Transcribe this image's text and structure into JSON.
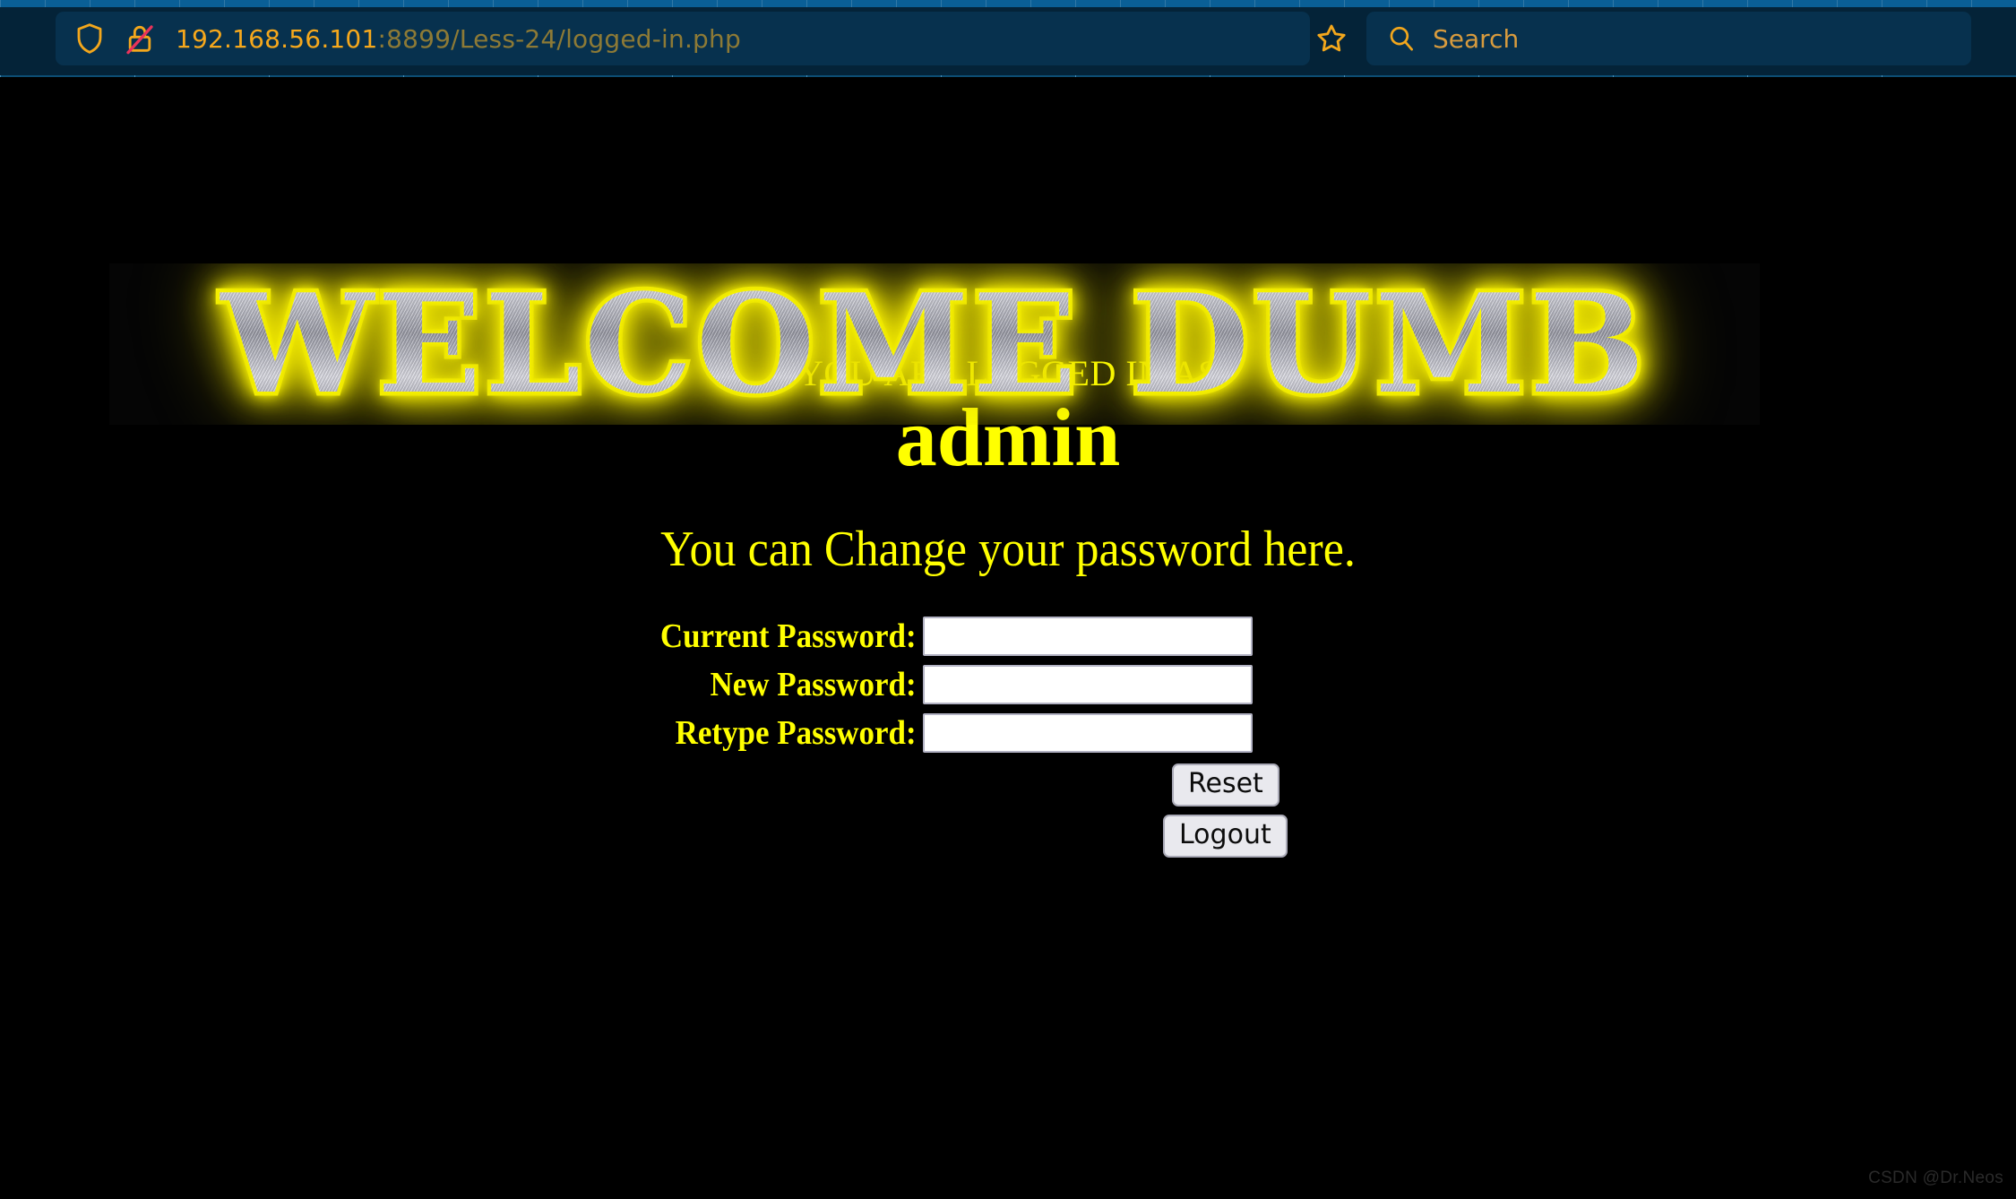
{
  "browser": {
    "url": {
      "host": "192.168.56.101",
      "rest": ":8899/Less-24/logged-in.php",
      "full": "192.168.56.101:8899/Less-24/logged-in.php"
    },
    "icons": {
      "shield": "shield-icon",
      "lock": "lock-crossed-out-icon",
      "bookmark": "bookmark-star-icon",
      "search": "search-icon"
    },
    "search": {
      "placeholder": "Search",
      "value": ""
    },
    "colors": {
      "chrome_bg": "#042338",
      "field_bg": "#07314e",
      "tabstrip": "#0a5f96",
      "url_host_text": "#f6a81c",
      "url_path_text": "#8d7a36"
    }
  },
  "page": {
    "background": "#000000",
    "accent": "#ffff00",
    "banner": {
      "text": "WELCOME DUMB",
      "style": "chrome-metallic-with-yellow-glow"
    },
    "logged_in_label": "YOU ARE LOGGED IN AS",
    "username": "admin",
    "change_password_heading": "You can Change your password here.",
    "form": {
      "rows": [
        {
          "label": "Current Password:",
          "value": "",
          "name": "current-password-field"
        },
        {
          "label": "New Password:",
          "value": "",
          "name": "new-password-field"
        },
        {
          "label": "Retype Password:",
          "value": "",
          "name": "retype-password-field"
        }
      ],
      "reset_label": "Reset",
      "logout_label": "Logout"
    },
    "watermark": "CSDN @Dr.Neos"
  }
}
